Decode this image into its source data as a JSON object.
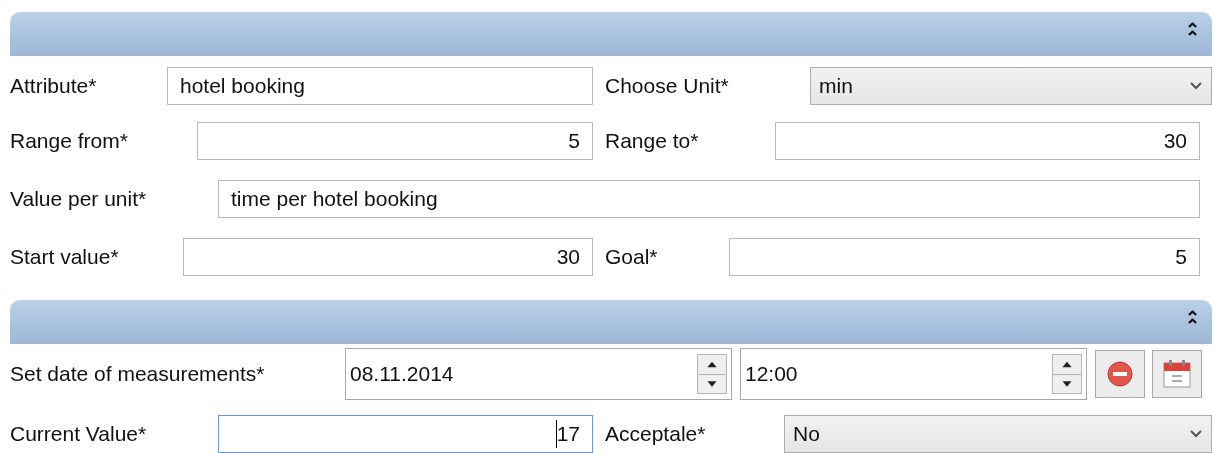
{
  "panels": [
    {
      "collapse_icon": "⌃",
      "rows": [
        {
          "cells": [
            {
              "kind": "label",
              "text": "Attribute*"
            },
            {
              "kind": "text",
              "value": "hotel booking"
            },
            {
              "kind": "label",
              "text": "Choose Unit*"
            },
            {
              "kind": "select",
              "value": "min"
            }
          ]
        },
        {
          "cells": [
            {
              "kind": "label",
              "text": "Range from*"
            },
            {
              "kind": "number",
              "value": "5"
            },
            {
              "kind": "label",
              "text": "Range to*"
            },
            {
              "kind": "number",
              "value": "30"
            }
          ]
        },
        {
          "cells": [
            {
              "kind": "label",
              "text": "Value per unit*"
            },
            {
              "kind": "text",
              "value": "time per hotel booking"
            }
          ]
        },
        {
          "cells": [
            {
              "kind": "label",
              "text": "Start value*"
            },
            {
              "kind": "number",
              "value": "30"
            },
            {
              "kind": "label",
              "text": "Goal*"
            },
            {
              "kind": "number",
              "value": "5"
            }
          ]
        }
      ]
    },
    {
      "collapse_icon": "⌃",
      "rows": [
        {
          "cells": [
            {
              "kind": "label",
              "text": "Set date of measurements*"
            },
            {
              "kind": "spin",
              "value": "08.11.2014"
            },
            {
              "kind": "spin",
              "value": "12:00"
            },
            {
              "kind": "clear"
            },
            {
              "kind": "calendar"
            }
          ]
        },
        {
          "cells": [
            {
              "kind": "label",
              "text": "Current Value*"
            },
            {
              "kind": "number",
              "value": "17",
              "focused": true
            },
            {
              "kind": "label",
              "text": "Acceptale*"
            },
            {
              "kind": "select",
              "value": "No"
            }
          ]
        }
      ]
    }
  ]
}
